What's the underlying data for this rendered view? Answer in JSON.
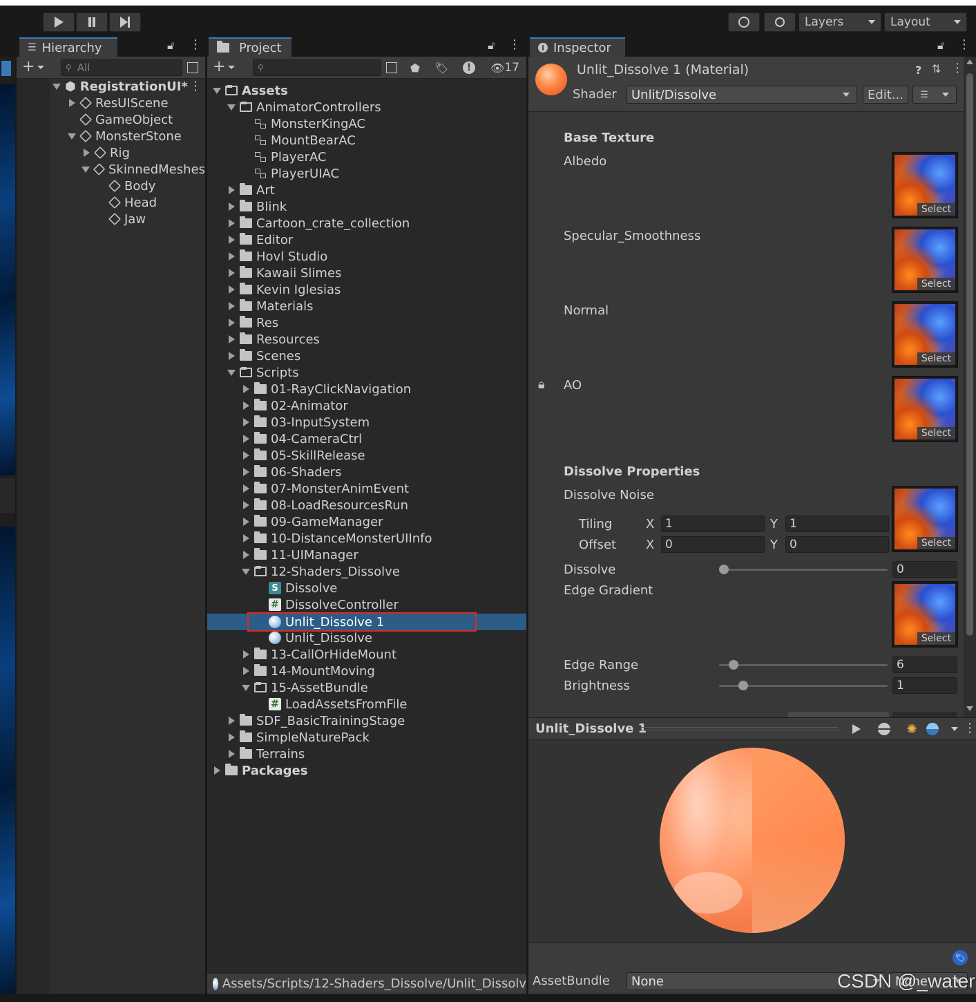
{
  "toolbar": {
    "layers_label": "Layers",
    "layout_label": "Layout"
  },
  "hierarchy": {
    "tab_label": "Hierarchy",
    "search_placeholder": "All",
    "scene_name": "RegistrationUI*",
    "items": [
      {
        "label": "ResUIScene"
      },
      {
        "label": "GameObject"
      },
      {
        "label": "MonsterStone"
      },
      {
        "label": "Rig"
      },
      {
        "label": "SkinnedMeshes"
      },
      {
        "label": "Body"
      },
      {
        "label": "Head"
      },
      {
        "label": "Jaw"
      }
    ]
  },
  "project": {
    "tab_label": "Project",
    "hidden_count": "17",
    "root": "Assets",
    "items": [
      {
        "label": "AnimatorControllers"
      },
      {
        "label": "MonsterKingAC"
      },
      {
        "label": "MountBearAC"
      },
      {
        "label": "PlayerAC"
      },
      {
        "label": "PlayerUIAC"
      },
      {
        "label": "Art"
      },
      {
        "label": "Blink"
      },
      {
        "label": "Cartoon_crate_collection"
      },
      {
        "label": "Editor"
      },
      {
        "label": "Hovl Studio"
      },
      {
        "label": "Kawaii Slimes"
      },
      {
        "label": "Kevin Iglesias"
      },
      {
        "label": "Materials"
      },
      {
        "label": "Res"
      },
      {
        "label": "Resources"
      },
      {
        "label": "Scenes"
      },
      {
        "label": "Scripts"
      },
      {
        "label": "01-RayClickNavigation"
      },
      {
        "label": "02-Animator"
      },
      {
        "label": "03-InputSystem"
      },
      {
        "label": "04-CameraCtrl"
      },
      {
        "label": "05-SkillRelease"
      },
      {
        "label": "06-Shaders"
      },
      {
        "label": "07-MonsterAnimEvent"
      },
      {
        "label": "08-LoadResourcesRun"
      },
      {
        "label": "09-GameManager"
      },
      {
        "label": "10-DistanceMonsterUIInfo"
      },
      {
        "label": "11-UIManager"
      },
      {
        "label": "12-Shaders_Dissolve"
      },
      {
        "label": "Dissolve"
      },
      {
        "label": "DissolveController"
      },
      {
        "label": "Unlit_Dissolve 1"
      },
      {
        "label": "Unlit_Dissolve"
      },
      {
        "label": "13-CallOrHideMount"
      },
      {
        "label": "14-MountMoving"
      },
      {
        "label": "15-AssetBundle"
      },
      {
        "label": "LoadAssetsFromFile"
      },
      {
        "label": "SDF_BasicTrainingStage"
      },
      {
        "label": "SimpleNaturePack"
      },
      {
        "label": "Terrains"
      }
    ],
    "packages": "Packages",
    "footer_path": "Assets/Scripts/12-Shaders_Dissolve/Unlit_Dissolv"
  },
  "inspector": {
    "tab_label": "Inspector",
    "material_title": "Unlit_Dissolve 1 (Material)",
    "shader_label": "Shader",
    "shader_value": "Unlit/Dissolve",
    "edit_button": "Edit...",
    "sections": {
      "base_texture": "Base Texture",
      "dissolve_properties": "Dissolve Properties"
    },
    "properties": {
      "albedo": "Albedo",
      "specular": "Specular_Smoothness",
      "normal": "Normal",
      "ao": "AO",
      "dissolve_noise": "Dissolve Noise",
      "tiling": "Tiling",
      "offset": "Offset",
      "dissolve": "Dissolve",
      "edge_gradient": "Edge Gradient",
      "edge_range": "Edge Range",
      "brightness": "Brightness"
    },
    "axis_x": "X",
    "axis_y": "Y",
    "tiling_x": "1",
    "tiling_y": "1",
    "offset_x": "0",
    "offset_y": "0",
    "dissolve_value": "0",
    "dissolve_fraction": 0.0,
    "edge_range_value": "6",
    "edge_range_fraction": 0.06,
    "brightness_value": "1",
    "brightness_fraction": 0.12,
    "select_label": "Select",
    "preview_title": "Unlit_Dissolve 1",
    "assetbundle_label": "AssetBundle",
    "assetbundle_value": "None",
    "assetbundle_variant": "None"
  },
  "watermark": "CSDN @_water",
  "colors": {
    "selection": "#2c5d87",
    "highlight_box": "#e0262b",
    "tab_accent": "#3a79bb"
  }
}
